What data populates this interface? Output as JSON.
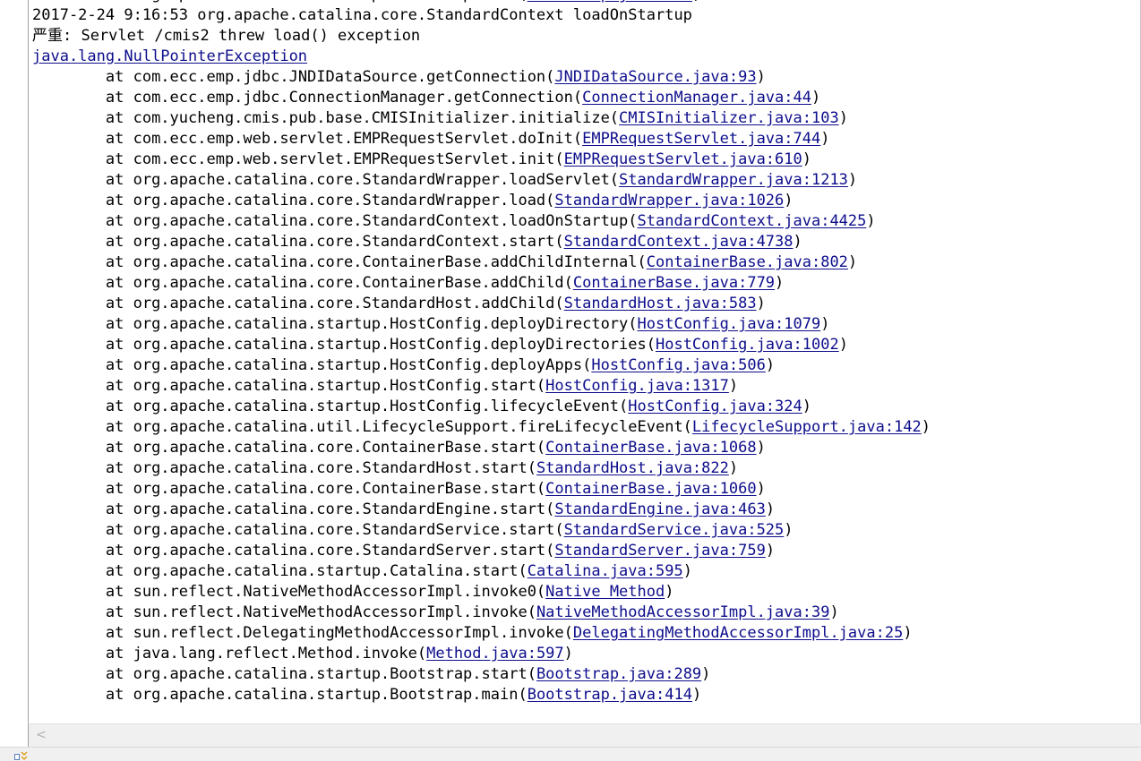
{
  "console": {
    "lines": [
      {
        "text": "\tat org.apache.catalina.startup.Bootstrap.main(",
        "link": "Bootstrap.java:414",
        "tail": ")"
      },
      {
        "text": "2017-2-24 9:16:53 org.apache.catalina.core.StandardContext loadOnStartup",
        "link": "",
        "tail": ""
      },
      {
        "text": "严重: Servlet /cmis2 threw load() exception",
        "link": "",
        "tail": ""
      },
      {
        "text": "",
        "link": "java.lang.NullPointerException",
        "tail": ""
      },
      {
        "text": "\tat com.ecc.emp.jdbc.JNDIDataSource.getConnection(",
        "link": "JNDIDataSource.java:93",
        "tail": ")"
      },
      {
        "text": "\tat com.ecc.emp.jdbc.ConnectionManager.getConnection(",
        "link": "ConnectionManager.java:44",
        "tail": ")"
      },
      {
        "text": "\tat com.yucheng.cmis.pub.base.CMISInitializer.initialize(",
        "link": "CMISInitializer.java:103",
        "tail": ")"
      },
      {
        "text": "\tat com.ecc.emp.web.servlet.EMPRequestServlet.doInit(",
        "link": "EMPRequestServlet.java:744",
        "tail": ")"
      },
      {
        "text": "\tat com.ecc.emp.web.servlet.EMPRequestServlet.init(",
        "link": "EMPRequestServlet.java:610",
        "tail": ")"
      },
      {
        "text": "\tat org.apache.catalina.core.StandardWrapper.loadServlet(",
        "link": "StandardWrapper.java:1213",
        "tail": ")"
      },
      {
        "text": "\tat org.apache.catalina.core.StandardWrapper.load(",
        "link": "StandardWrapper.java:1026",
        "tail": ")"
      },
      {
        "text": "\tat org.apache.catalina.core.StandardContext.loadOnStartup(",
        "link": "StandardContext.java:4425",
        "tail": ")"
      },
      {
        "text": "\tat org.apache.catalina.core.StandardContext.start(",
        "link": "StandardContext.java:4738",
        "tail": ")"
      },
      {
        "text": "\tat org.apache.catalina.core.ContainerBase.addChildInternal(",
        "link": "ContainerBase.java:802",
        "tail": ")"
      },
      {
        "text": "\tat org.apache.catalina.core.ContainerBase.addChild(",
        "link": "ContainerBase.java:779",
        "tail": ")"
      },
      {
        "text": "\tat org.apache.catalina.core.StandardHost.addChild(",
        "link": "StandardHost.java:583",
        "tail": ")"
      },
      {
        "text": "\tat org.apache.catalina.startup.HostConfig.deployDirectory(",
        "link": "HostConfig.java:1079",
        "tail": ")"
      },
      {
        "text": "\tat org.apache.catalina.startup.HostConfig.deployDirectories(",
        "link": "HostConfig.java:1002",
        "tail": ")"
      },
      {
        "text": "\tat org.apache.catalina.startup.HostConfig.deployApps(",
        "link": "HostConfig.java:506",
        "tail": ")"
      },
      {
        "text": "\tat org.apache.catalina.startup.HostConfig.start(",
        "link": "HostConfig.java:1317",
        "tail": ")"
      },
      {
        "text": "\tat org.apache.catalina.startup.HostConfig.lifecycleEvent(",
        "link": "HostConfig.java:324",
        "tail": ")"
      },
      {
        "text": "\tat org.apache.catalina.util.LifecycleSupport.fireLifecycleEvent(",
        "link": "LifecycleSupport.java:142",
        "tail": ")"
      },
      {
        "text": "\tat org.apache.catalina.core.ContainerBase.start(",
        "link": "ContainerBase.java:1068",
        "tail": ")"
      },
      {
        "text": "\tat org.apache.catalina.core.StandardHost.start(",
        "link": "StandardHost.java:822",
        "tail": ")"
      },
      {
        "text": "\tat org.apache.catalina.core.ContainerBase.start(",
        "link": "ContainerBase.java:1060",
        "tail": ")"
      },
      {
        "text": "\tat org.apache.catalina.core.StandardEngine.start(",
        "link": "StandardEngine.java:463",
        "tail": ")"
      },
      {
        "text": "\tat org.apache.catalina.core.StandardService.start(",
        "link": "StandardService.java:525",
        "tail": ")"
      },
      {
        "text": "\tat org.apache.catalina.core.StandardServer.start(",
        "link": "StandardServer.java:759",
        "tail": ")"
      },
      {
        "text": "\tat org.apache.catalina.startup.Catalina.start(",
        "link": "Catalina.java:595",
        "tail": ")"
      },
      {
        "text": "\tat sun.reflect.NativeMethodAccessorImpl.invoke0(",
        "link": "Native Method",
        "tail": ")"
      },
      {
        "text": "\tat sun.reflect.NativeMethodAccessorImpl.invoke(",
        "link": "NativeMethodAccessorImpl.java:39",
        "tail": ")"
      },
      {
        "text": "\tat sun.reflect.DelegatingMethodAccessorImpl.invoke(",
        "link": "DelegatingMethodAccessorImpl.java:25",
        "tail": ")"
      },
      {
        "text": "\tat java.lang.reflect.Method.invoke(",
        "link": "Method.java:597",
        "tail": ")"
      },
      {
        "text": "\tat org.apache.catalina.startup.Bootstrap.start(",
        "link": "Bootstrap.java:289",
        "tail": ")"
      },
      {
        "text": "\tat org.apache.catalina.startup.Bootstrap.main(",
        "link": "Bootstrap.java:414",
        "tail": ")"
      }
    ]
  },
  "colors": {
    "link": "#0d0d8c",
    "text": "#000000",
    "background": "#ffffff"
  },
  "icons": {
    "scroll_left": "chevron-left-icon",
    "status": "status-console-icon"
  }
}
